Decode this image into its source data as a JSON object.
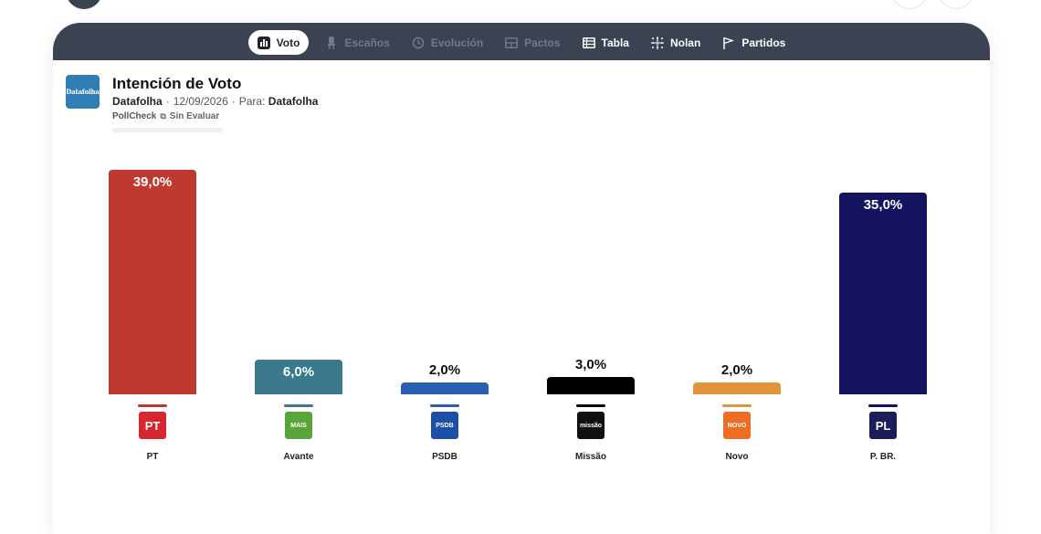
{
  "nav": {
    "tabs": [
      {
        "label": "Voto",
        "icon": "bar-chart-icon",
        "state": "active"
      },
      {
        "label": "Escaños",
        "icon": "seat-icon",
        "state": "disabled"
      },
      {
        "label": "Evolución",
        "icon": "history-icon",
        "state": "disabled"
      },
      {
        "label": "Pactos",
        "icon": "pacts-icon",
        "state": "disabled"
      },
      {
        "label": "Tabla",
        "icon": "table-icon",
        "state": "normal"
      },
      {
        "label": "Nolan",
        "icon": "nolan-grid-icon",
        "state": "normal"
      },
      {
        "label": "Partidos",
        "icon": "flag-icon",
        "state": "normal"
      }
    ]
  },
  "header": {
    "logo_text": "Datafolha",
    "title": "Intención de Voto",
    "pollster": "Datafolha",
    "date": "12/09/2026",
    "para_label": "Para:",
    "client": "Datafolha",
    "pollcheck_label": "PollCheck",
    "pollcheck_status": "Sin Evaluar"
  },
  "chart_data": {
    "type": "bar",
    "categories": [
      "PT",
      "Avante",
      "PSDB",
      "Missão",
      "Novo",
      "P. BR."
    ],
    "values": [
      39.0,
      6.0,
      2.0,
      3.0,
      2.0,
      35.0
    ],
    "value_labels": [
      "39,0%",
      "6,0%",
      "2,0%",
      "3,0%",
      "2,0%",
      "35,0%"
    ],
    "colors": [
      "#c0392f",
      "#3a7a8c",
      "#2a5fb0",
      "#000000",
      "#e0953a",
      "#13135f"
    ],
    "logo_text": [
      "PT",
      "MAIS",
      "PSDB",
      "missão",
      "NOVO",
      "PL"
    ],
    "logo_colors": [
      "#d6262f",
      "#5aa53a",
      "#1c4fa8",
      "#111111",
      "#ee6d22",
      "#1d1d5c"
    ],
    "title": "",
    "xlabel": "",
    "ylabel": "",
    "ylim": [
      0,
      39
    ]
  }
}
